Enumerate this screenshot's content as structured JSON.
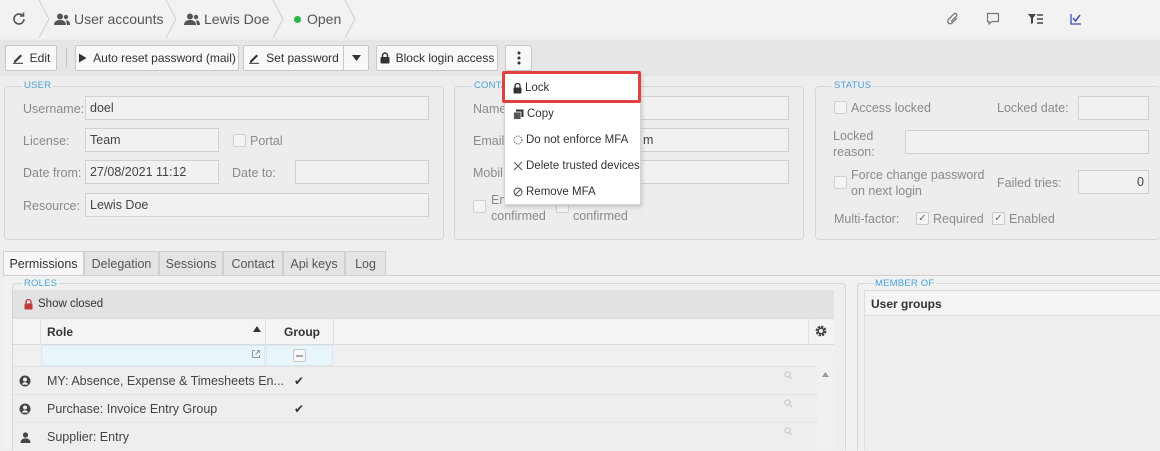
{
  "breadcrumb": {
    "refresh_icon": "refresh-icon",
    "user_accounts": "User accounts",
    "user_name": "Lewis Doe",
    "status": "Open",
    "status_color": "#2bb34a"
  },
  "top_icons": [
    "paperclip-icon",
    "comment-icon",
    "filter-list-icon",
    "checklist-icon"
  ],
  "toolbar": {
    "edit": "Edit",
    "auto_reset": "Auto reset password (mail)",
    "set_password": "Set password",
    "block_login": "Block login access"
  },
  "context_menu": {
    "items": [
      "Lock",
      "Copy",
      "Do not enforce MFA",
      "Delete trusted devices",
      "Remove MFA"
    ],
    "highlight_color": "#e04040"
  },
  "user_panel": {
    "title": "USER",
    "username_label": "Username:",
    "username": "doel",
    "license_label": "License:",
    "license": "Team",
    "portal_label": "Portal",
    "date_from_label": "Date from:",
    "date_from": "27/08/2021 11:12",
    "date_to_label": "Date to:",
    "date_to": "",
    "resource_label": "Resource:",
    "resource": "Lewis Doe"
  },
  "contact_panel": {
    "title": "CONTA",
    "name_label": "Name",
    "email_label": "Email:",
    "email_tail": "m",
    "mobile_label": "Mobil",
    "email_confirmed_a": "Em",
    "email_confirmed_b": "confirmed",
    "mobile_confirmed": "confirmed"
  },
  "status_panel": {
    "title": "STATUS",
    "access_locked": "Access locked",
    "locked_date_label": "Locked date:",
    "locked_reason_label_1": "Locked",
    "locked_reason_label_2": "reason:",
    "force_change_1": "Force change password",
    "force_change_2": "on next login",
    "failed_tries_label": "Failed tries:",
    "failed_tries": "0",
    "multifactor_label": "Multi-factor:",
    "required": "Required",
    "enabled": "Enabled"
  },
  "tabs": [
    "Permissions",
    "Delegation",
    "Sessions",
    "Contact",
    "Api keys",
    "Log"
  ],
  "roles": {
    "title": "ROLES",
    "show_closed": "Show closed",
    "col_role": "Role",
    "col_group": "Group",
    "rows": [
      {
        "icon": "group-user-icon",
        "role": "MY: Absence, Expense & Timesheets En...",
        "group": "✔"
      },
      {
        "icon": "group-user-icon",
        "role": "Purchase: Invoice Entry Group",
        "group": "✔"
      },
      {
        "icon": "user-icon",
        "role": "Supplier: Entry",
        "group": ""
      }
    ]
  },
  "member_of": {
    "title": "MEMBER OF",
    "col_user_groups": "User groups"
  }
}
